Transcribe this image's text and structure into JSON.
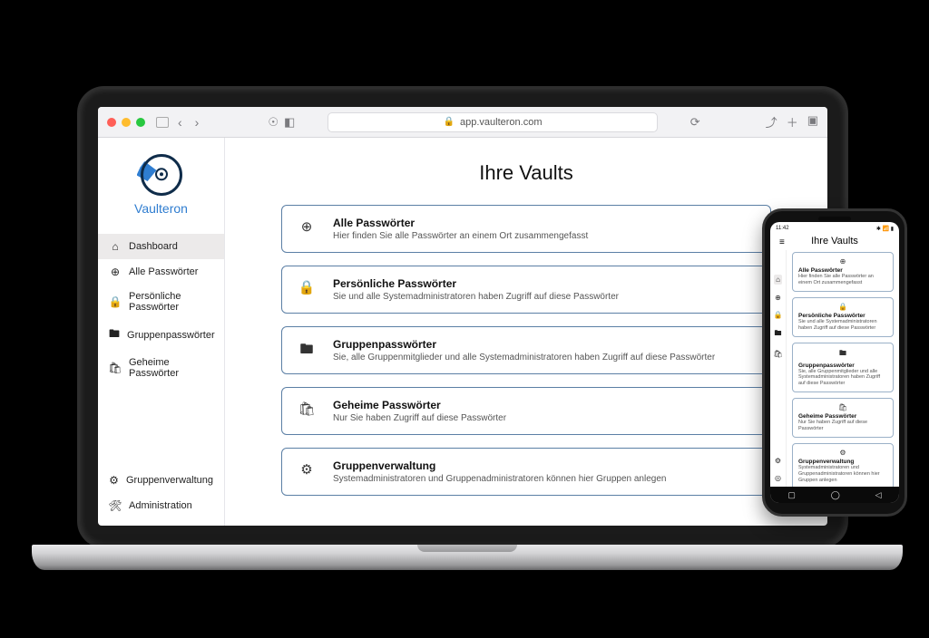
{
  "browser": {
    "url": "app.vaulteron.com"
  },
  "brand": {
    "name": "Vaulteron"
  },
  "heading": "Ihre Vaults",
  "sidebar": {
    "top": [
      {
        "icon": "home-icon",
        "glyph": "⌂",
        "label": "Dashboard",
        "active": true
      },
      {
        "icon": "globe-icon",
        "glyph": "⊕",
        "label": "Alle Passwörter"
      },
      {
        "icon": "lock-icon",
        "glyph": "🔒",
        "label": "Persönliche Passwörter"
      },
      {
        "icon": "folder-icon",
        "glyph": "🖿",
        "label": "Gruppenpasswörter"
      },
      {
        "icon": "secret-icon",
        "glyph": "🛍",
        "label": "Geheime Passwörter"
      }
    ],
    "bottom": [
      {
        "icon": "org-icon",
        "glyph": "⚙",
        "label": "Gruppenverwaltung"
      },
      {
        "icon": "admin-icon",
        "glyph": "🛠",
        "label": "Administration"
      }
    ]
  },
  "cards": [
    {
      "icon": "globe-icon",
      "glyph": "⊕",
      "title": "Alle Passwörter",
      "sub": "Hier finden Sie alle Passwörter an einem Ort zusammengefasst"
    },
    {
      "icon": "lock-icon",
      "glyph": "🔒",
      "title": "Persönliche Passwörter",
      "sub": "Sie und alle Systemadministratoren haben Zugriff auf diese Passwörter"
    },
    {
      "icon": "folder-icon",
      "glyph": "🖿",
      "title": "Gruppenpasswörter",
      "sub": "Sie, alle Gruppenmitglieder und alle Systemadministratoren haben Zugriff auf diese Passwörter"
    },
    {
      "icon": "secret-icon",
      "glyph": "🛍",
      "title": "Geheime Passwörter",
      "sub": "Nur Sie haben Zugriff auf diese Passwörter"
    },
    {
      "icon": "org-icon",
      "glyph": "⚙",
      "title": "Gruppenverwaltung",
      "sub": "Systemadministratoren und Gruppenadministratoren können hier Gruppen anlegen"
    }
  ],
  "phone": {
    "time": "11:42",
    "status": "✱ 📶 ▮",
    "heading": "Ihre Vaults",
    "railGlyphs": [
      "⌂",
      "⊕",
      "🔒",
      "🖿",
      "🛍"
    ],
    "railBottomGlyphs": [
      "⚙",
      "◎"
    ],
    "cards": [
      {
        "glyph": "⊕",
        "title": "Alle Passwörter",
        "sub": "Hier finden Sie alle Passwörter an einem Ort zusammengefasst"
      },
      {
        "glyph": "🔒",
        "title": "Persönliche Passwörter",
        "sub": "Sie und alle Systemadministratoren haben Zugriff auf diese Passwörter"
      },
      {
        "glyph": "🖿",
        "title": "Gruppenpasswörter",
        "sub": "Sie, alle Gruppenmitglieder und alle Systemadministratoren haben Zugriff auf diese Passwörter"
      },
      {
        "glyph": "🛍",
        "title": "Geheime Passwörter",
        "sub": "Nur Sie haben Zugriff auf diese Passwörter"
      },
      {
        "glyph": "⚙",
        "title": "Gruppenverwaltung",
        "sub": "Systemadministratoren und Gruppenadministratoren können hier Gruppen anlegen"
      }
    ]
  }
}
